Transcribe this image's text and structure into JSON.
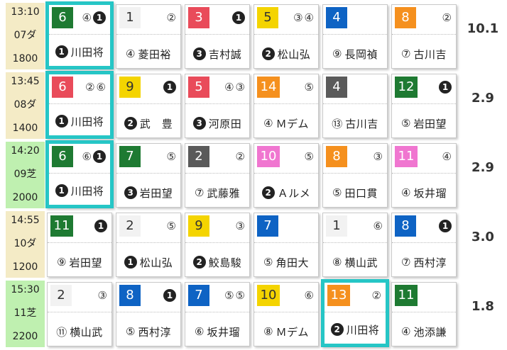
{
  "colors": {
    "white": "#ffffff",
    "black": "#222222",
    "red": "#e94b5a",
    "blue": "#0e63c4",
    "yellow": "#f4d400",
    "green": "#1e7a32",
    "orange": "#f5901e",
    "pink": "#f076d0",
    "gray": "#5a5a5a",
    "highlight": "#26c6c6"
  },
  "races": [
    {
      "time": "13:10",
      "race": "07ダ",
      "distance": "1800",
      "surface": "dirt",
      "odds": "10.1",
      "horses": [
        {
          "num": "6",
          "color": "green",
          "marks": [
            {
              "t": "④",
              "f": false
            },
            {
              "t": "❶",
              "f": true
            }
          ],
          "pmark": {
            "t": "❶",
            "f": true
          },
          "jockey": "川田将",
          "highlight": true
        },
        {
          "num": "1",
          "color": "white",
          "marks": [
            {
              "t": "②",
              "f": false
            }
          ],
          "pmark": {
            "t": "④",
            "f": false
          },
          "jockey": "菱田裕"
        },
        {
          "num": "3",
          "color": "red",
          "marks": [
            {
              "t": "❶",
              "f": true
            }
          ],
          "pmark": {
            "t": "❸",
            "f": true
          },
          "jockey": "吉村誠"
        },
        {
          "num": "5",
          "color": "yellow",
          "marks": [
            {
              "t": "③",
              "f": false
            },
            {
              "t": "④",
              "f": false
            }
          ],
          "pmark": {
            "t": "❷",
            "f": true
          },
          "jockey": "松山弘"
        },
        {
          "num": "4",
          "color": "blue",
          "marks": [],
          "pmark": {
            "t": "⑨",
            "f": false
          },
          "jockey": "長岡禎"
        },
        {
          "num": "8",
          "color": "orange",
          "marks": [
            {
              "t": "②",
              "f": false
            }
          ],
          "pmark": {
            "t": "⑦",
            "f": false
          },
          "jockey": "古川吉"
        }
      ]
    },
    {
      "time": "13:45",
      "race": "08ダ",
      "distance": "1400",
      "surface": "dirt",
      "odds": "2.9",
      "horses": [
        {
          "num": "6",
          "color": "red",
          "marks": [
            {
              "t": "②",
              "f": false
            },
            {
              "t": "⑥",
              "f": false
            }
          ],
          "pmark": {
            "t": "❶",
            "f": true
          },
          "jockey": "川田将",
          "highlight": true
        },
        {
          "num": "9",
          "color": "yellow",
          "marks": [
            {
              "t": "❶",
              "f": true
            }
          ],
          "pmark": {
            "t": "❷",
            "f": true
          },
          "jockey": "武　豊"
        },
        {
          "num": "5",
          "color": "red",
          "marks": [
            {
              "t": "④",
              "f": false
            },
            {
              "t": "③",
              "f": false
            }
          ],
          "pmark": {
            "t": "❸",
            "f": true
          },
          "jockey": "河原田"
        },
        {
          "num": "14",
          "color": "orange",
          "marks": [
            {
              "t": "⑤",
              "f": false
            }
          ],
          "pmark": {
            "t": "④",
            "f": false
          },
          "jockey": "Ｍデム"
        },
        {
          "num": "4",
          "color": "gray",
          "marks": [],
          "pmark": {
            "t": "⑬",
            "f": false
          },
          "jockey": "古川吉"
        },
        {
          "num": "12",
          "color": "green",
          "marks": [
            {
              "t": "❶",
              "f": true
            }
          ],
          "pmark": {
            "t": "⑤",
            "f": false
          },
          "jockey": "岩田望"
        }
      ]
    },
    {
      "time": "14:20",
      "race": "09芝",
      "distance": "2000",
      "surface": "turf",
      "odds": "2.9",
      "horses": [
        {
          "num": "6",
          "color": "green",
          "marks": [
            {
              "t": "⑥",
              "f": false
            },
            {
              "t": "❶",
              "f": true
            }
          ],
          "pmark": {
            "t": "❶",
            "f": true
          },
          "jockey": "川田将",
          "highlight": true
        },
        {
          "num": "7",
          "color": "green",
          "marks": [
            {
              "t": "⑤",
              "f": false
            }
          ],
          "pmark": {
            "t": "❸",
            "f": true
          },
          "jockey": "岩田望"
        },
        {
          "num": "2",
          "color": "gray",
          "marks": [
            {
              "t": "②",
              "f": false
            }
          ],
          "pmark": {
            "t": "⑦",
            "f": false
          },
          "jockey": "武藤雅"
        },
        {
          "num": "10",
          "color": "pink",
          "marks": [
            {
              "t": "⑤",
              "f": false
            }
          ],
          "pmark": {
            "t": "❷",
            "f": true
          },
          "jockey": "Ａルメ"
        },
        {
          "num": "8",
          "color": "orange",
          "marks": [
            {
              "t": "③",
              "f": false
            }
          ],
          "pmark": {
            "t": "⑤",
            "f": false
          },
          "jockey": "田口貫"
        },
        {
          "num": "11",
          "color": "pink",
          "marks": [
            {
              "t": "④",
              "f": false
            }
          ],
          "pmark": {
            "t": "④",
            "f": false
          },
          "jockey": "坂井瑠"
        }
      ]
    },
    {
      "time": "14:55",
      "race": "10ダ",
      "distance": "1200",
      "surface": "dirt",
      "odds": "3.0",
      "horses": [
        {
          "num": "11",
          "color": "green",
          "marks": [
            {
              "t": "❶",
              "f": true
            }
          ],
          "pmark": {
            "t": "⑨",
            "f": false
          },
          "jockey": "岩田望"
        },
        {
          "num": "2",
          "color": "white",
          "marks": [
            {
              "t": "⑤",
              "f": false
            }
          ],
          "pmark": {
            "t": "❶",
            "f": true
          },
          "jockey": "松山弘"
        },
        {
          "num": "9",
          "color": "yellow",
          "marks": [
            {
              "t": "③",
              "f": false
            }
          ],
          "pmark": {
            "t": "❷",
            "f": true
          },
          "jockey": "鮫島駿"
        },
        {
          "num": "7",
          "color": "blue",
          "marks": [],
          "pmark": {
            "t": "⑤",
            "f": false
          },
          "jockey": "角田大"
        },
        {
          "num": "1",
          "color": "white",
          "marks": [
            {
              "t": "⑥",
              "f": false
            }
          ],
          "pmark": {
            "t": "⑧",
            "f": false
          },
          "jockey": "横山武"
        },
        {
          "num": "8",
          "color": "blue",
          "marks": [
            {
              "t": "❶",
              "f": true
            }
          ],
          "pmark": {
            "t": "⑦",
            "f": false
          },
          "jockey": "西村淳"
        }
      ]
    },
    {
      "time": "15:30",
      "race": "11芝",
      "distance": "2200",
      "surface": "turf",
      "odds": "1.8",
      "horses": [
        {
          "num": "2",
          "color": "white",
          "marks": [
            {
              "t": "③",
              "f": false
            }
          ],
          "pmark": {
            "t": "⑪",
            "f": false
          },
          "jockey": "横山武"
        },
        {
          "num": "8",
          "color": "blue",
          "marks": [
            {
              "t": "❶",
              "f": true
            }
          ],
          "pmark": {
            "t": "⑤",
            "f": false
          },
          "jockey": "西村淳"
        },
        {
          "num": "7",
          "color": "blue",
          "marks": [
            {
              "t": "⑤",
              "f": false
            },
            {
              "t": "⑤",
              "f": false
            }
          ],
          "pmark": {
            "t": "⑥",
            "f": false
          },
          "jockey": "坂井瑠"
        },
        {
          "num": "10",
          "color": "yellow",
          "marks": [
            {
              "t": "⑥",
              "f": false
            }
          ],
          "pmark": {
            "t": "⑧",
            "f": false
          },
          "jockey": "Ｍデム"
        },
        {
          "num": "13",
          "color": "orange",
          "marks": [
            {
              "t": "②",
              "f": false
            }
          ],
          "pmark": {
            "t": "❷",
            "f": true
          },
          "jockey": "川田将",
          "highlight": true
        },
        {
          "num": "11",
          "color": "green",
          "marks": [],
          "pmark": {
            "t": "④",
            "f": false
          },
          "jockey": "池添謙"
        }
      ]
    }
  ]
}
